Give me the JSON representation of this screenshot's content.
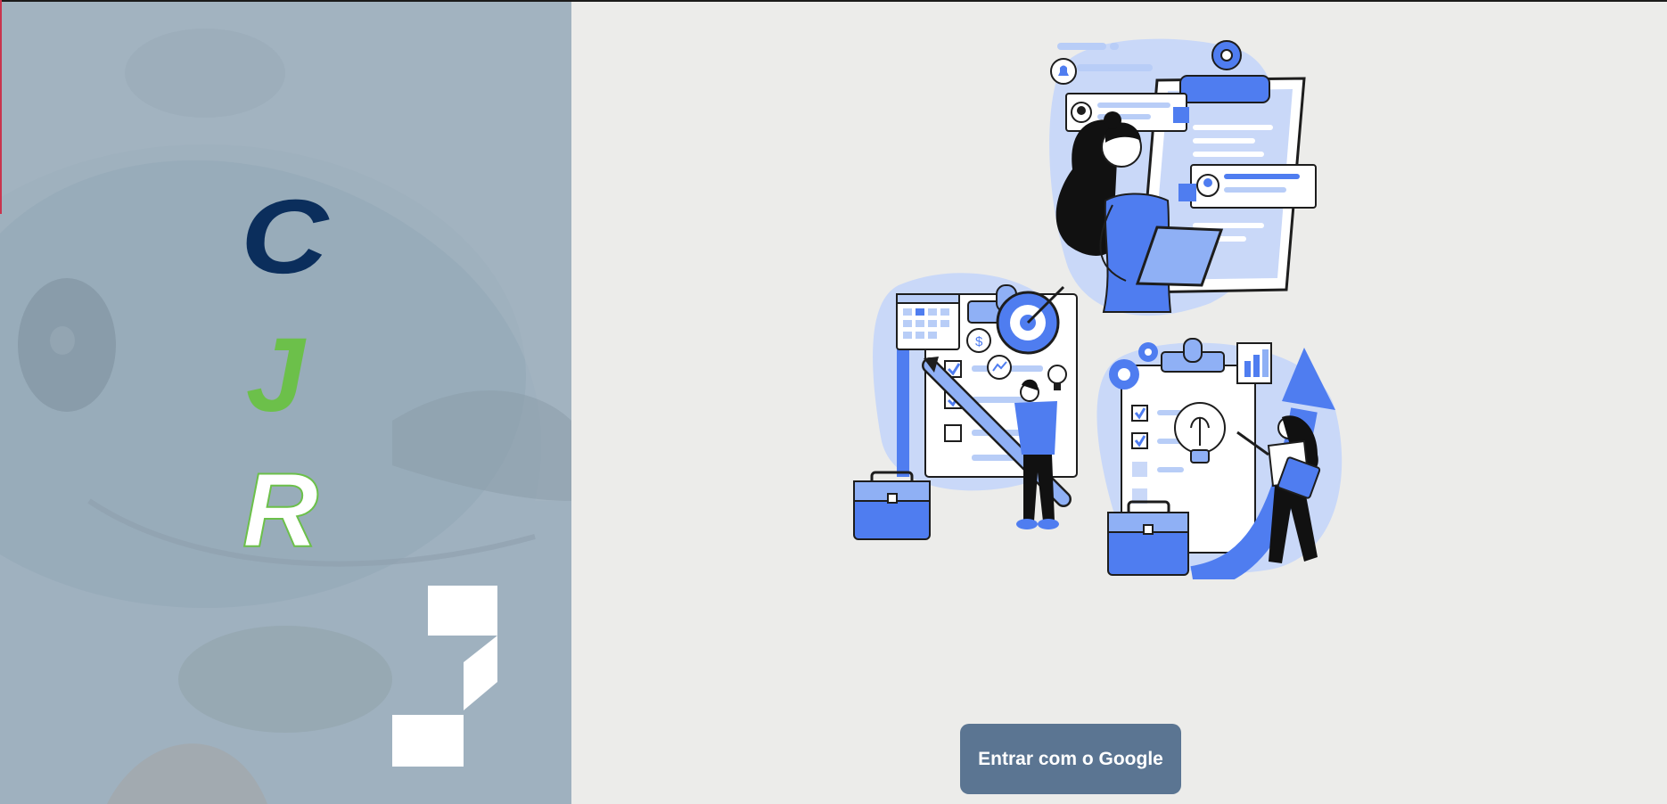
{
  "brand": {
    "letters": [
      "C",
      "J",
      "R"
    ],
    "colors": {
      "c": "#0b2e5c",
      "j": "#6cc04a",
      "r": "#ffffff",
      "panel": "#9fb1bf",
      "background": "#ececea",
      "button": "#5b7592",
      "accent": "#4f7df0"
    }
  },
  "login": {
    "google_button_label": "Entrar com o Google"
  },
  "illustration": {
    "icon": "planning-checklist-illustration"
  }
}
